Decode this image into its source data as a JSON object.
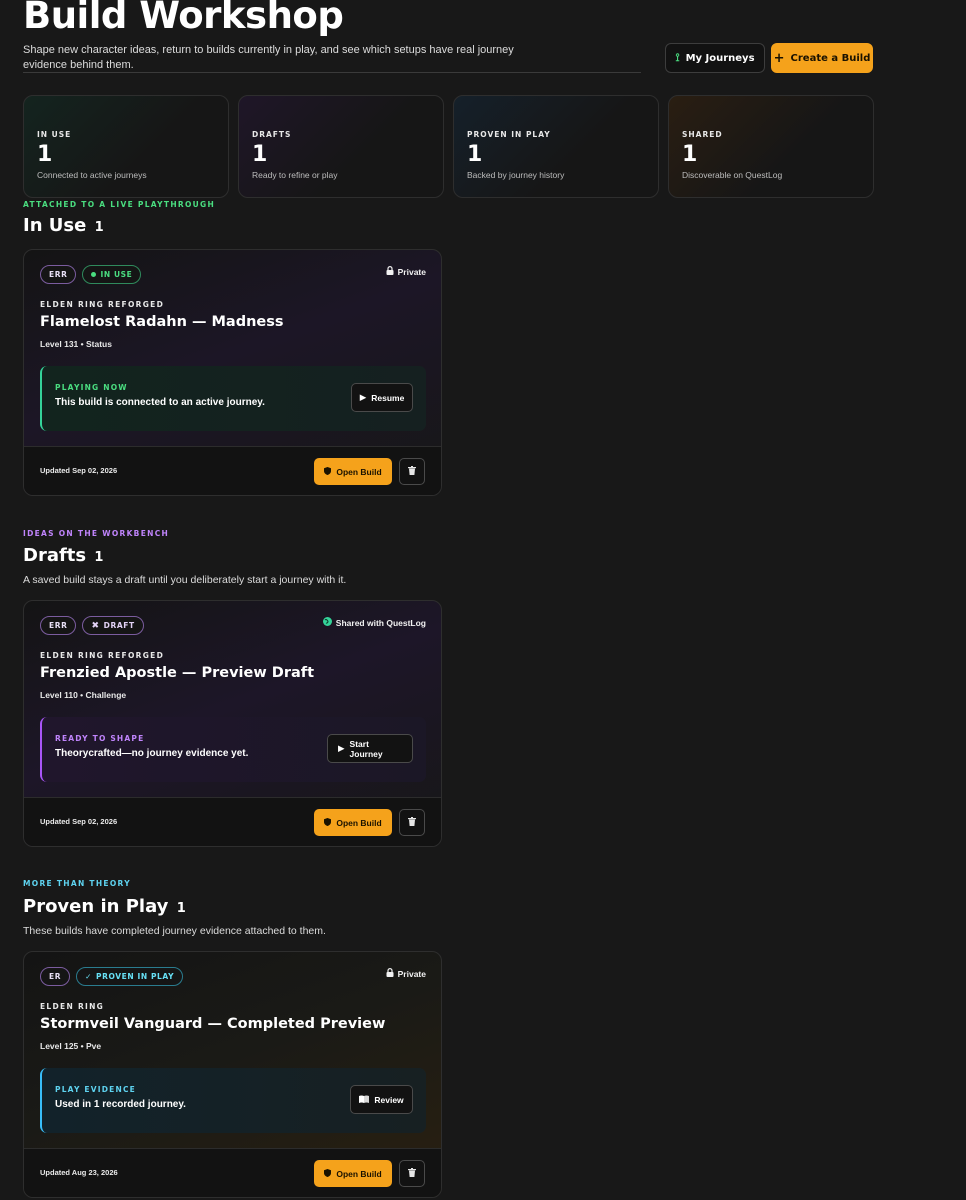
{
  "header": {
    "title": "Build Workshop",
    "subtitle": "Shape new character ideas, return to builds currently in play, and see which setups have real journey evidence behind them.",
    "my_journeys_label": "My Journeys",
    "create_build_label": "Create a Build"
  },
  "stats": [
    {
      "label": "IN USE",
      "value": "1",
      "desc": "Connected to active journeys"
    },
    {
      "label": "DRAFTS",
      "value": "1",
      "desc": "Ready to refine or play"
    },
    {
      "label": "PROVEN IN PLAY",
      "value": "1",
      "desc": "Backed by journey history"
    },
    {
      "label": "SHARED",
      "value": "1",
      "desc": "Discoverable on QuestLog"
    }
  ],
  "sections": {
    "in_use": {
      "eyebrow": "ATTACHED TO A LIVE PLAYTHROUGH",
      "title": "In Use",
      "count": "1",
      "card": {
        "game_badge": "ERR",
        "status_badge": "IN USE",
        "visibility": "Private",
        "game": "ELDEN RING REFORGED",
        "name": "Flamelost Radahn — Madness",
        "meta": "Level 131 • Status",
        "panel_label": "PLAYING NOW",
        "panel_text": "This build is connected to an active journey.",
        "panel_button": "Resume",
        "updated": "Updated Sep 02, 2026",
        "open_label": "Open Build"
      }
    },
    "drafts": {
      "eyebrow": "IDEAS ON THE WORKBENCH",
      "title": "Drafts",
      "count": "1",
      "desc": "A saved build stays a draft until you deliberately start a journey with it.",
      "card": {
        "game_badge": "ERR",
        "status_badge": "DRAFT",
        "visibility": "Shared with QuestLog",
        "game": "ELDEN RING REFORGED",
        "name": "Frenzied Apostle — Preview Draft",
        "meta": "Level 110 • Challenge",
        "panel_label": "READY TO SHAPE",
        "panel_text": "Theorycrafted—no journey evidence yet.",
        "panel_button": "Start Journey",
        "updated": "Updated Sep 02, 2026",
        "open_label": "Open Build"
      }
    },
    "proven": {
      "eyebrow": "MORE THAN THEORY",
      "title": "Proven in Play",
      "count": "1",
      "desc": "These builds have completed journey evidence attached to them.",
      "card": {
        "game_badge": "ER",
        "status_badge": "PROVEN IN PLAY",
        "visibility": "Private",
        "game": "ELDEN RING",
        "name": "Stormveil Vanguard — Completed Preview",
        "meta": "Level 125 • Pve",
        "panel_label": "PLAY EVIDENCE",
        "panel_text": "Used in 1 recorded journey.",
        "panel_button": "Review",
        "updated": "Updated Aug 23, 2026",
        "open_label": "Open Build"
      }
    }
  },
  "colors": {
    "accent": "#f5a21b",
    "in_use": "#4ade80",
    "draft": "#c084fc",
    "proven": "#5ed3f0",
    "background": "#181818"
  }
}
